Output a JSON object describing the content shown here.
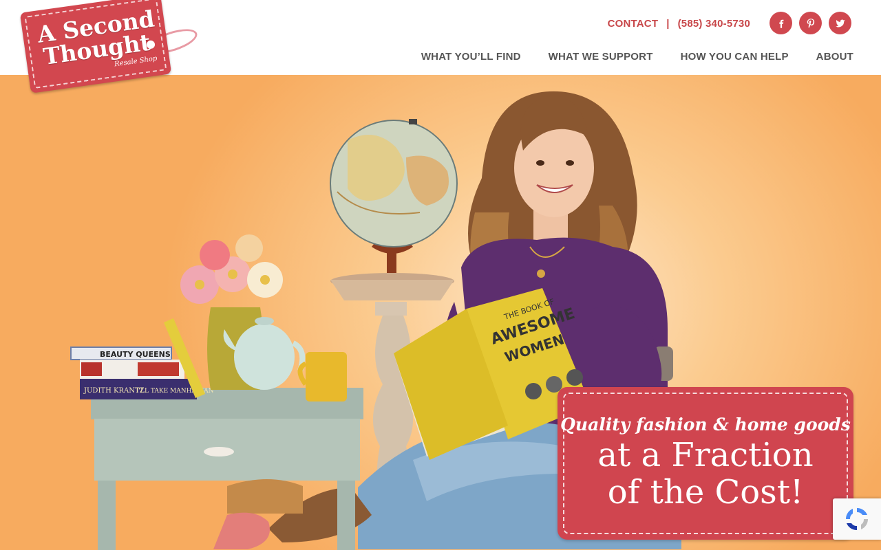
{
  "brand": {
    "name_line1": "A Second",
    "name_line2": "Thought",
    "tagline": "Resale Shop",
    "color": "#d2474f"
  },
  "header": {
    "contact_label": "CONTACT",
    "separator": "|",
    "phone": "(585) 340-5730",
    "social": [
      {
        "icon": "facebook-icon"
      },
      {
        "icon": "pinterest-icon"
      },
      {
        "icon": "twitter-icon"
      }
    ],
    "nav": [
      {
        "label": "WHAT YOU’LL FIND"
      },
      {
        "label": "WHAT WE SUPPORT"
      },
      {
        "label": "HOW YOU CAN HELP"
      },
      {
        "label": "ABOUT"
      }
    ]
  },
  "hero": {
    "book_titles": [
      "BEAUTY QUEENS",
      "JUDITH KRANTZ",
      "I'LL TAKE MANHATTAN"
    ],
    "held_book": {
      "line1": "THE BOOK OF",
      "line2": "AWESOME",
      "line3": "WOMEN"
    },
    "promo": {
      "script_line": "Quality fashion & home goods",
      "line1": "at a Fraction",
      "line2": "of the Cost!"
    }
  },
  "recaptcha": {
    "icon": "recaptcha-icon"
  },
  "colors": {
    "accent": "#d0454f",
    "nav_text": "#555555",
    "hero_bg": "#f7ab5f"
  }
}
